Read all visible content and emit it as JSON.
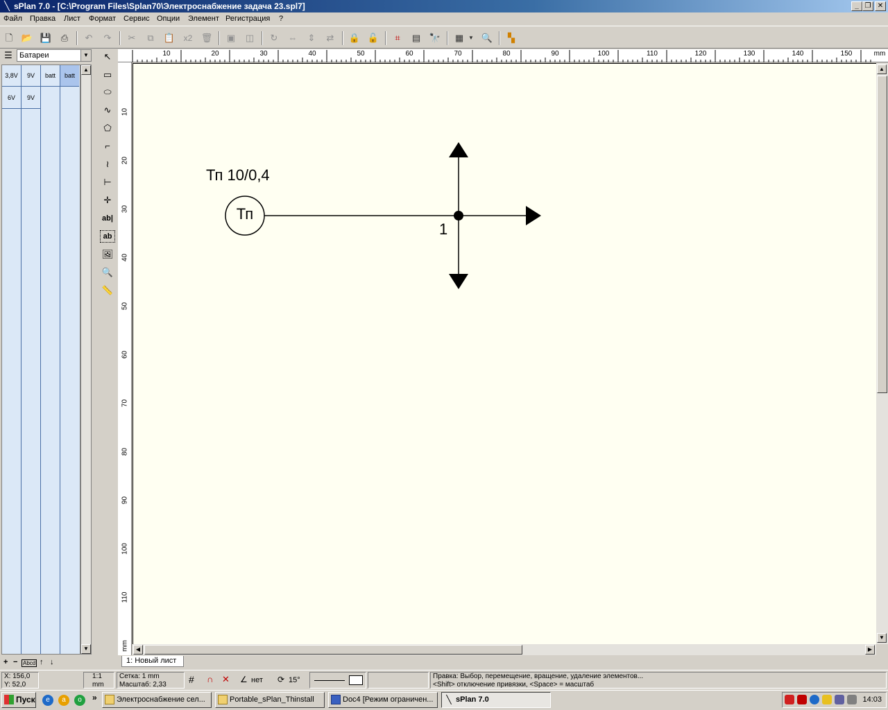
{
  "window": {
    "title": "sPlan 7.0 - [C:\\Program Files\\Splan70\\Электроснабжение задача 23.spl7]",
    "minimize": "_",
    "restore": "❐",
    "close": "✕"
  },
  "menu": [
    "Файл",
    "Правка",
    "Лист",
    "Формат",
    "Сервис",
    "Опции",
    "Элемент",
    "Регистрация",
    "?"
  ],
  "toolbar": {
    "icons": [
      "new-file-icon",
      "open-file-icon",
      "save-icon",
      "print-icon",
      "undo-icon",
      "redo-icon",
      "cut-icon",
      "copy-icon",
      "paste-icon",
      "duplicate-icon",
      "delete-icon",
      "group-icon",
      "ungroup-icon",
      "rotate-icon",
      "mirror-h-icon",
      "mirror-v-icon",
      "flip-icon",
      "lock-icon",
      "unlock-icon",
      "snap-icon",
      "page-icon",
      "find-icon",
      "grid-icon",
      "zoom-icon",
      "colors-icon"
    ],
    "duplicate_label": "x2"
  },
  "library": {
    "selected": "Батареи",
    "cells": [
      {
        "label": "3,8V",
        "selected": false
      },
      {
        "label": "9V",
        "selected": false
      },
      {
        "label": "batt",
        "selected": false
      },
      {
        "label": "batt",
        "selected": true
      },
      {
        "label": "6V",
        "selected": false
      },
      {
        "label": "9V",
        "selected": false
      }
    ],
    "bottom_controls": [
      "+",
      "−",
      "Abcd",
      "↑",
      "↓"
    ]
  },
  "tools": {
    "icons": [
      "pointer-icon",
      "rectangle-icon",
      "ellipse-icon",
      "freehand-icon",
      "polygon-icon",
      "polyline-icon",
      "bezier-icon",
      "dimension-icon",
      "junction-icon",
      "text-icon",
      "textbox-icon",
      "image-icon",
      "magnifier-icon",
      "measure-icon"
    ],
    "text_label": "ab|",
    "textbox_label": "ab"
  },
  "ruler": {
    "h_labels": [
      "10",
      "20",
      "30",
      "40",
      "50",
      "60",
      "70",
      "80",
      "90",
      "100",
      "110",
      "120",
      "130",
      "140",
      "150"
    ],
    "h_unit": "mm",
    "v_labels": [
      "10",
      "20",
      "30",
      "40",
      "50",
      "60",
      "70",
      "80",
      "90",
      "100",
      "110"
    ],
    "v_unit": "mm"
  },
  "drawing": {
    "transformer_label": "Тп 10/0,4",
    "transformer_symbol": "Тп",
    "node_label": "1"
  },
  "sheet_tab": "1: Новый лист",
  "status": {
    "x": "X: 156,0",
    "y": "Y: 52,0",
    "ratio": "1:1",
    "unit": "mm",
    "grid": "Сетка: 1 mm",
    "scale": "Масштаб:   2,33",
    "angle_snap": "нет",
    "rotation": "15°",
    "hint_line1": "Правка: Выбор, перемещение, вращение, удаление элементов...",
    "hint_line2": "<Shift> отключение привязки, <Space> = масштаб"
  },
  "taskbar": {
    "start": "Пуск",
    "tasks": [
      {
        "label": "Электроснабжение сел...",
        "active": false
      },
      {
        "label": "Portable_sPlan_Thinstall",
        "active": false
      },
      {
        "label": "Doc4 [Режим ограничен...",
        "active": false
      },
      {
        "label": "sPlan 7.0",
        "active": true
      }
    ],
    "clock": "14:03"
  }
}
